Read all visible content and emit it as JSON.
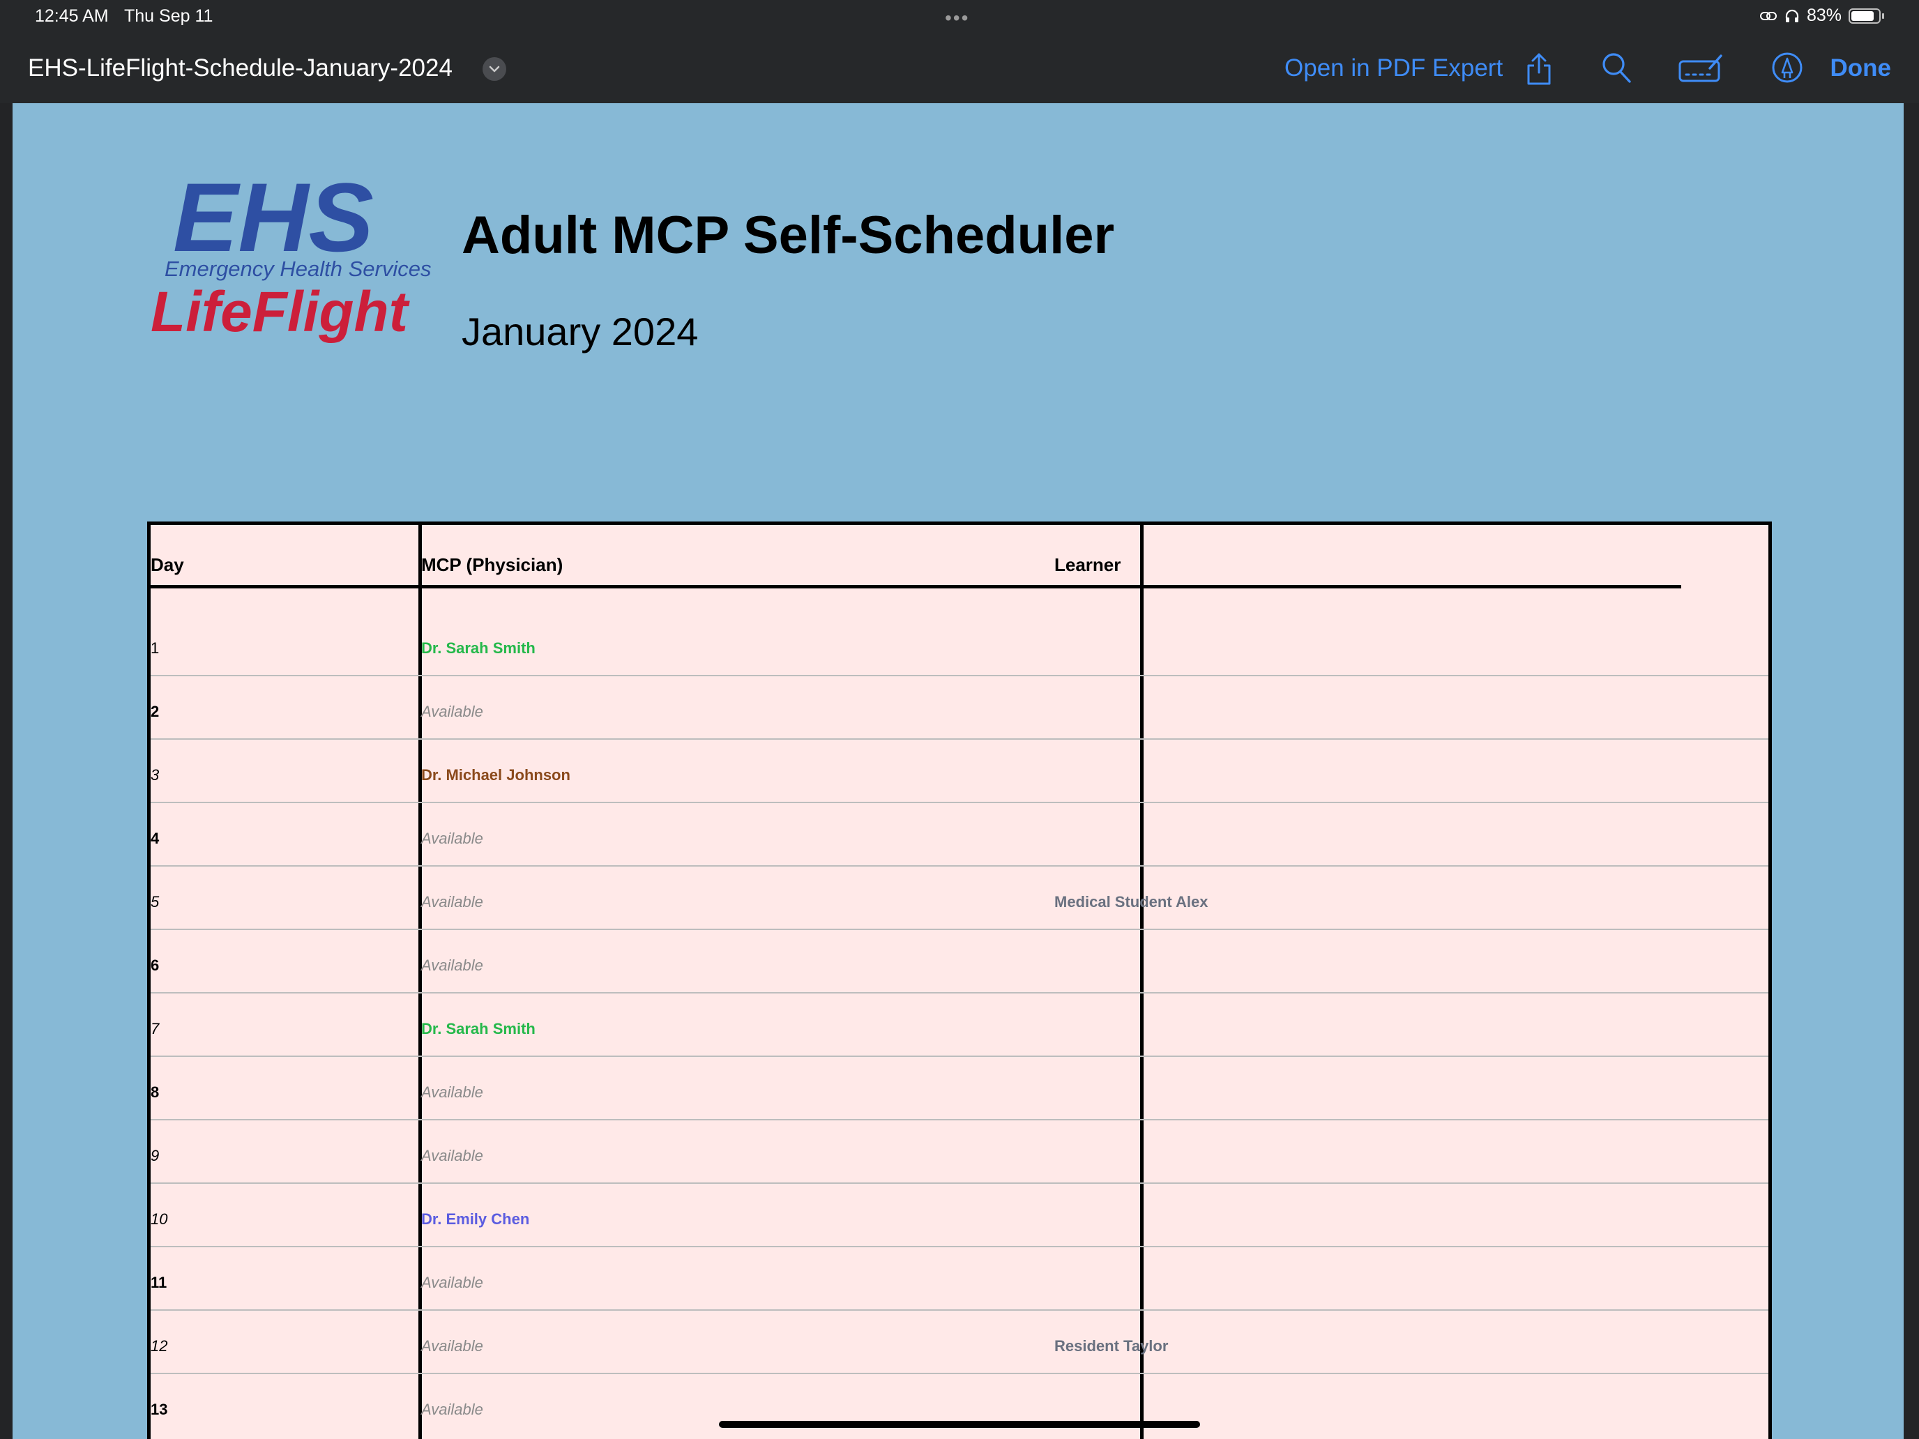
{
  "status_bar": {
    "time": "12:45 AM",
    "date": "Thu Sep 11",
    "battery": "83%",
    "battery_level": 0.83
  },
  "toolbar": {
    "document_title": "EHS-LifeFlight-Schedule-January-2024",
    "open_in_label": "Open in PDF Expert",
    "done_label": "Done",
    "accent_color": "#3f8cf6"
  },
  "document": {
    "logo": {
      "brand": "EHS",
      "tagline": "Emergency Health Services",
      "product": "LifeFlight"
    },
    "heading": "Adult MCP Self-Scheduler",
    "subheading": "January 2024",
    "table": {
      "headers": {
        "day": "Day",
        "mcp": "MCP (Physician)",
        "learner": "Learner"
      },
      "rows": [
        {
          "day": "1",
          "mcp": "Dr. Sarah Smith",
          "mcp_color": "#25b84a",
          "learner": "",
          "day_style": "normal"
        },
        {
          "day": "2",
          "mcp": "Available",
          "mcp_color": "",
          "learner": "",
          "day_style": "bold"
        },
        {
          "day": "3",
          "mcp": "Dr. Michael Johnson",
          "mcp_color": "#8b4a1c",
          "learner": "",
          "day_style": "italic"
        },
        {
          "day": "4",
          "mcp": "Available",
          "mcp_color": "",
          "learner": "",
          "day_style": "bold"
        },
        {
          "day": "5",
          "mcp": "Available",
          "mcp_color": "",
          "learner": "Medical Student Alex",
          "day_style": "italic"
        },
        {
          "day": "6",
          "mcp": "Available",
          "mcp_color": "",
          "learner": "",
          "day_style": "bold"
        },
        {
          "day": "7",
          "mcp": "Dr. Sarah Smith",
          "mcp_color": "#25b84a",
          "learner": "",
          "day_style": "italic"
        },
        {
          "day": "8",
          "mcp": "Available",
          "mcp_color": "",
          "learner": "",
          "day_style": "bold"
        },
        {
          "day": "9",
          "mcp": "Available",
          "mcp_color": "",
          "learner": "",
          "day_style": "italic"
        },
        {
          "day": "10",
          "mcp": "Dr. Emily Chen",
          "mcp_color": "#5b5ce0",
          "learner": "",
          "day_style": "italic"
        },
        {
          "day": "11",
          "mcp": "Available",
          "mcp_color": "",
          "learner": "",
          "day_style": "bold"
        },
        {
          "day": "12",
          "mcp": "Available",
          "mcp_color": "",
          "learner": "Resident Taylor",
          "day_style": "italic"
        },
        {
          "day": "13",
          "mcp": "Available",
          "mcp_color": "",
          "learner": "",
          "day_style": "bold"
        }
      ]
    }
  }
}
